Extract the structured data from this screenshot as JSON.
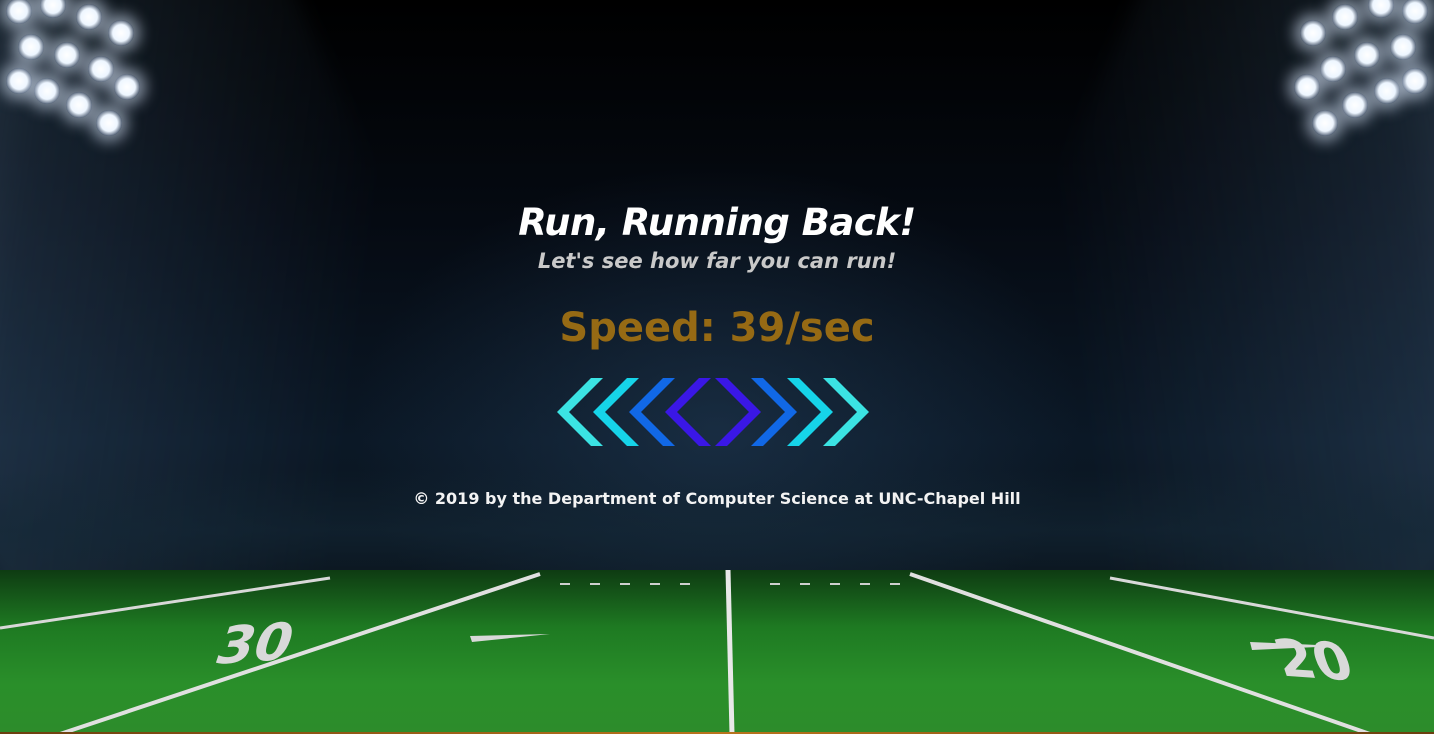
{
  "title": "Run, Running Back!",
  "subtitle": "Let's see how far you can run!",
  "speed": {
    "text": "Speed: 39/sec",
    "color": "#966a14"
  },
  "controls": {
    "left": {
      "icon": "chevron-left-group-icon",
      "colors": [
        "#3be3e3",
        "#16d4e9",
        "#1168e6",
        "#3a17e6"
      ]
    },
    "right": {
      "icon": "chevron-right-group-icon",
      "colors": [
        "#3a17e6",
        "#1168e6",
        "#16d4e9",
        "#3be3e3"
      ]
    }
  },
  "footer": "© 2019 by the Department of Computer Science at UNC-Chapel Hill",
  "field": {
    "numbers": [
      "30",
      "20"
    ],
    "grass_color": "#2a8f2a"
  }
}
